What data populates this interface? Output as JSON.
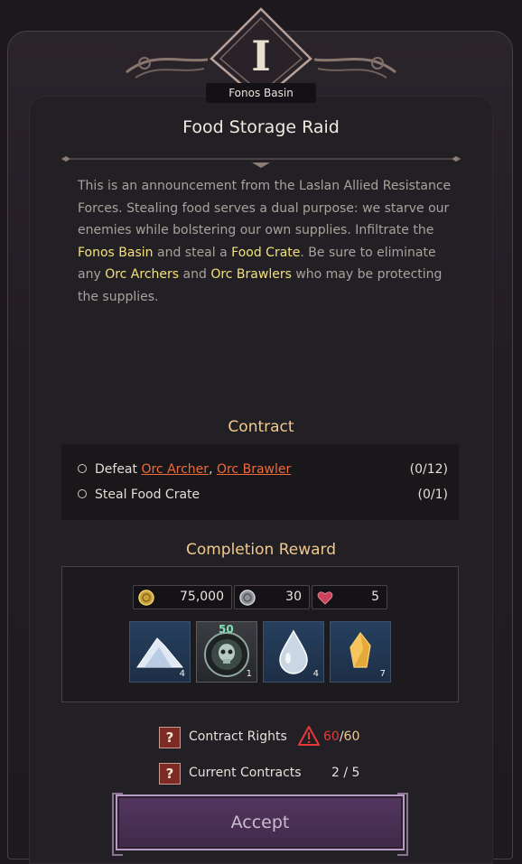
{
  "header": {
    "numeral": "I",
    "region": "Fonos Basin"
  },
  "quest": {
    "title": "Food Storage Raid",
    "description": {
      "p1": "This is an announcement from the Laslan Allied Resistance Forces. Stealing food serves a dual purpose: we starve our enemies while bolstering our own supplies. Infiltrate the ",
      "hl1": "Fonos Basin",
      "p2": " and steal a ",
      "hl2": "Food Crate",
      "p3": ". Be sure to eliminate any ",
      "hl3": "Orc Archers",
      "p4": " and ",
      "hl4": "Orc Brawlers",
      "p5": " who may be protecting the supplies."
    }
  },
  "contract": {
    "title": "Contract",
    "objectives": [
      {
        "prefix": "Defeat ",
        "target1": "Orc Archer",
        "sep": ", ",
        "target2": "Orc Brawler",
        "count": "(0/12)"
      },
      {
        "text": "Steal Food Crate",
        "count": "(0/1)"
      }
    ]
  },
  "reward": {
    "title": "Completion Reward",
    "currencies": [
      {
        "icon": "gold-coin-icon",
        "amount": "75,000"
      },
      {
        "icon": "silver-coin-icon",
        "amount": "30"
      },
      {
        "icon": "heart-icon",
        "amount": "5"
      }
    ],
    "items": [
      {
        "icon": "crystal-powder-icon",
        "qty": "4"
      },
      {
        "icon": "skull-orb-icon",
        "qty": "1",
        "level": "50"
      },
      {
        "icon": "water-drop-icon",
        "qty": "4"
      },
      {
        "icon": "amber-crystal-icon",
        "qty": "7"
      }
    ]
  },
  "info": {
    "contract_rights_label": "Contract Rights",
    "contract_rights_current": "60",
    "contract_rights_sep": "/",
    "contract_rights_max": "60",
    "current_contracts_label": "Current Contracts",
    "current_contracts_value": "2 / 5",
    "help_glyph": "?"
  },
  "actions": {
    "accept_label": "Accept"
  },
  "colors": {
    "highlight": "#f3e07a",
    "enemy": "#ef6a3c",
    "warning": "#e5393a",
    "section_title": "#f0c98e"
  }
}
